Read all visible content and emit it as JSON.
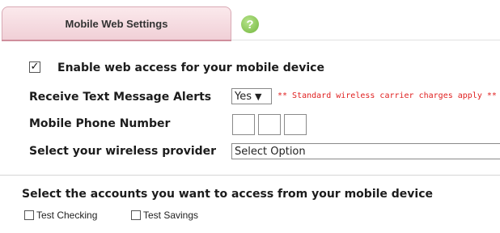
{
  "tab": {
    "label": "Mobile Web Settings"
  },
  "help": {
    "glyph": "?"
  },
  "enable": {
    "checked": true,
    "check_glyph": "✓",
    "label": "Enable web access for your mobile device"
  },
  "alerts": {
    "label": "Receive Text Message Alerts",
    "value": "Yes",
    "note": "** Standard wireless carrier charges apply **"
  },
  "phone": {
    "label": "Mobile Phone Number"
  },
  "provider": {
    "label": "Select your wireless provider",
    "value": "Select Option"
  },
  "accounts": {
    "heading": "Select the accounts you want to access from your mobile device",
    "items": [
      {
        "label": "Test Checking",
        "checked": false
      },
      {
        "label": "Test Savings",
        "checked": false
      }
    ]
  },
  "colors": {
    "tab_accent": "#cf8e9c",
    "help_green": "#73b63d",
    "note_red": "#e02020"
  }
}
